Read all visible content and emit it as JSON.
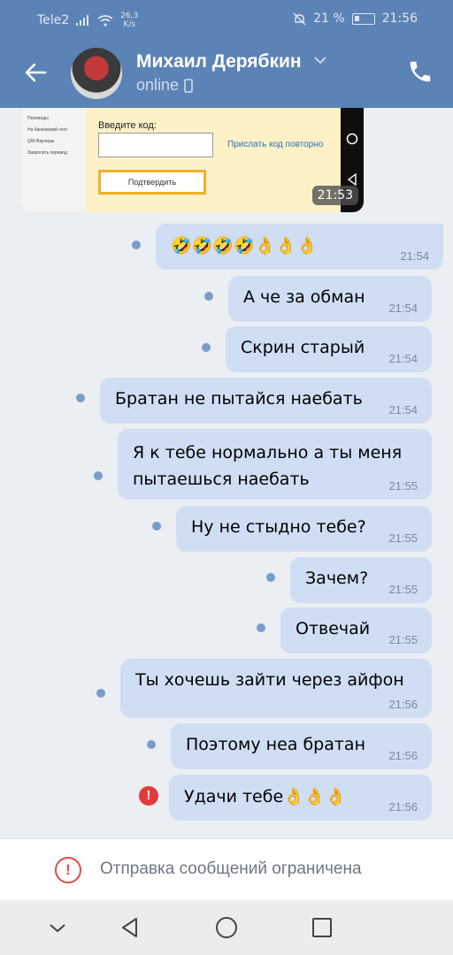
{
  "statusbar": {
    "carrier": "Tele2",
    "speed_value": "26,3",
    "speed_unit": "K/s",
    "battery_pct": "21 %",
    "clock": "21:56"
  },
  "header": {
    "name": "Михаил Дерябкин",
    "status": "online"
  },
  "screenshot_msg": {
    "sidebar_items": [
      "Переводы",
      "На банковский счет",
      "QW Ваучеры",
      "Запросить перевод"
    ],
    "code_label": "Введите код:",
    "resend_link": "Прислать код повторно",
    "confirm_button": "Подтвердить",
    "time": "21:53"
  },
  "messages": [
    {
      "text": "🤣🤣🤣🤣👌👌👌",
      "time": "21:54"
    },
    {
      "text": "А че за обман",
      "time": "21:54"
    },
    {
      "text": "Скрин старый",
      "time": "21:54"
    },
    {
      "text": "Братан не пытайся наебать",
      "time": "21:54"
    },
    {
      "text": "Я к тебе нормально а ты меня\nпытаешься наебать",
      "time": "21:55"
    },
    {
      "text": "Ну не стыдно тебе?",
      "time": "21:55"
    },
    {
      "text": "Зачем?",
      "time": "21:55"
    },
    {
      "text": "Отвечай",
      "time": "21:55"
    },
    {
      "text": "Ты хочешь зайти через айфон",
      "time": "21:56"
    },
    {
      "text": "Поэтому неа братан",
      "time": "21:56"
    },
    {
      "text": "Удачи тебе👌👌👌",
      "time": "21:56"
    }
  ],
  "error_badge": "!",
  "footer": {
    "restricted_icon": "!",
    "restricted_text": "Отправка сообщений ограничена"
  },
  "colors": {
    "header_bg": "#5b83b6",
    "bubble_bg": "#cfdef3",
    "chat_bg": "#ebeef3",
    "error_red": "#e23a3a"
  }
}
